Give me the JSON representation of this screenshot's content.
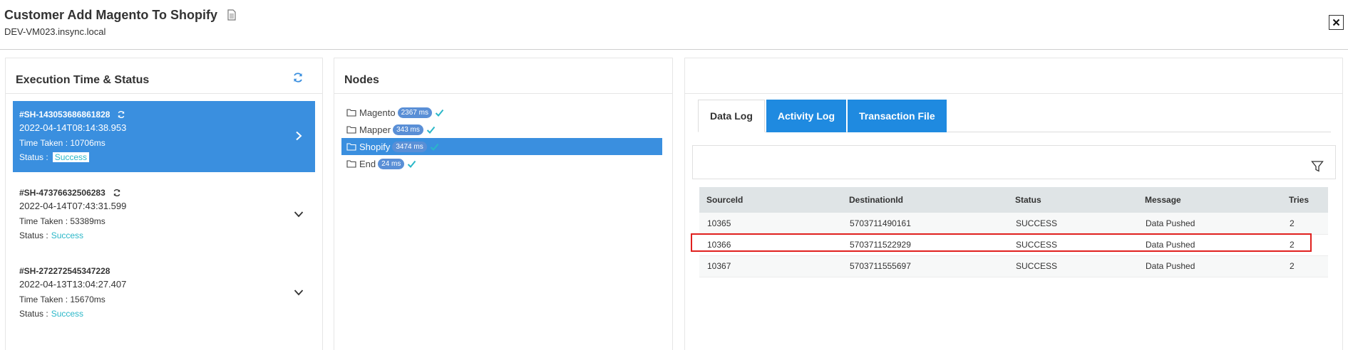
{
  "header": {
    "title": "Customer Add Magento To Shopify",
    "subtitle": "DEV-VM023.insync.local"
  },
  "execution_panel": {
    "title": "Execution Time & Status",
    "time_taken_label": "Time Taken :",
    "status_label": "Status :",
    "items": [
      {
        "id": "#SH-143053686861828",
        "date": "2022-04-14T08:14:38.953",
        "time_taken": "10706ms",
        "status": "Success"
      },
      {
        "id": "#SH-47376632506283",
        "date": "2022-04-14T07:43:31.599",
        "time_taken": "53389ms",
        "status": "Success"
      },
      {
        "id": "#SH-272272545347228",
        "date": "2022-04-13T13:04:27.407",
        "time_taken": "15670ms",
        "status": "Success"
      }
    ]
  },
  "nodes_panel": {
    "title": "Nodes",
    "nodes": [
      {
        "name": "Magento",
        "duration": "2367 ms"
      },
      {
        "name": "Mapper",
        "duration": "343 ms"
      },
      {
        "name": "Shopify",
        "duration": "3474 ms"
      },
      {
        "name": "End",
        "duration": "24 ms"
      }
    ]
  },
  "log_panel": {
    "tabs": [
      "Data Log",
      "Activity Log",
      "Transaction File"
    ],
    "columns": [
      "SourceId",
      "DestinationId",
      "Status",
      "Message",
      "Tries"
    ],
    "rows": [
      [
        "10365",
        "5703711490161",
        "SUCCESS",
        "Data Pushed",
        "2"
      ],
      [
        "10366",
        "5703711522929",
        "SUCCESS",
        "Data Pushed",
        "2"
      ],
      [
        "10367",
        "5703711555697",
        "SUCCESS",
        "Data Pushed",
        "2"
      ]
    ]
  },
  "colors": {
    "accent": "#3a8fdf",
    "tab_blue": "#1f8ae0",
    "success": "#2ab7c8",
    "badge": "#5a8fd6",
    "highlight": "#e0201e"
  },
  "icons": [
    "document-icon",
    "close-icon",
    "refresh-icon",
    "chevron-right-icon",
    "chevron-down-icon",
    "folder-icon",
    "check-icon",
    "filter-icon"
  ]
}
